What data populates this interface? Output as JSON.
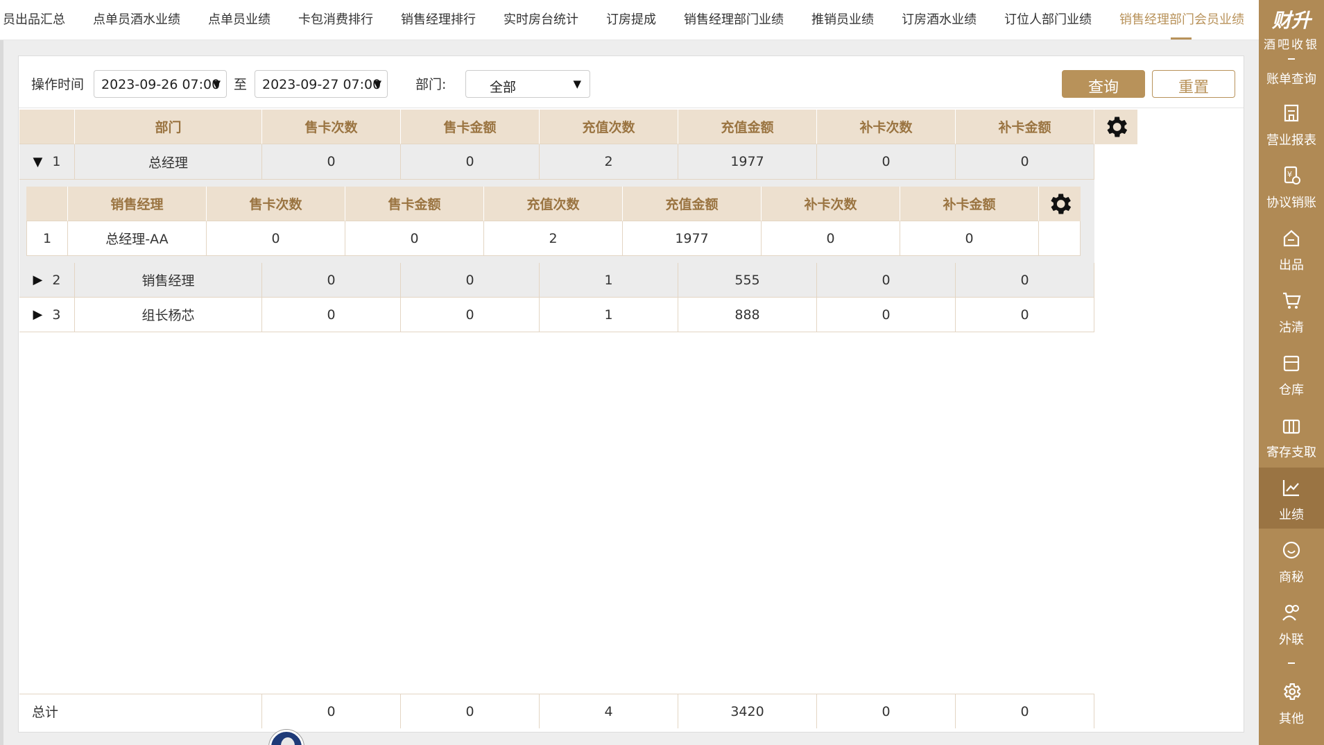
{
  "tabs": [
    {
      "label": "员出品汇总",
      "active": false
    },
    {
      "label": "点单员酒水业绩",
      "active": false
    },
    {
      "label": "点单员业绩",
      "active": false
    },
    {
      "label": "卡包消费排行",
      "active": false
    },
    {
      "label": "销售经理排行",
      "active": false
    },
    {
      "label": "实时房台统计",
      "active": false
    },
    {
      "label": "订房提成",
      "active": false
    },
    {
      "label": "销售经理部门业绩",
      "active": false
    },
    {
      "label": "推销员业绩",
      "active": false
    },
    {
      "label": "订房酒水业绩",
      "active": false
    },
    {
      "label": "订位人部门业绩",
      "active": false
    },
    {
      "label": "销售经理部门会员业绩",
      "active": true
    }
  ],
  "filters": {
    "time_label": "操作时间",
    "start": "2023-09-26 07:00",
    "to_label": "至",
    "end": "2023-09-27 07:00",
    "dept_label": "部门:",
    "dept_value": "全部",
    "query_label": "查询",
    "reset_label": "重置"
  },
  "table": {
    "columns": [
      "部门",
      "售卡次数",
      "售卡金额",
      "充值次数",
      "充值金额",
      "补卡次数",
      "补卡金额"
    ],
    "rows": [
      {
        "index": "1",
        "expanded": true,
        "dept": "总经理",
        "values": [
          "0",
          "0",
          "2",
          "1977",
          "0",
          "0"
        ]
      },
      {
        "index": "2",
        "expanded": false,
        "dept": "销售经理",
        "values": [
          "0",
          "0",
          "1",
          "555",
          "0",
          "0"
        ]
      },
      {
        "index": "3",
        "expanded": false,
        "dept": "组长杨芯",
        "values": [
          "0",
          "0",
          "1",
          "888",
          "0",
          "0"
        ]
      }
    ]
  },
  "subtable": {
    "columns": [
      "销售经理",
      "售卡次数",
      "售卡金额",
      "充值次数",
      "充值金额",
      "补卡次数",
      "补卡金额"
    ],
    "rows": [
      {
        "index": "1",
        "name": "总经理-AA",
        "values": [
          "0",
          "0",
          "2",
          "1977",
          "0",
          "0"
        ]
      }
    ]
  },
  "total": {
    "label": "总计",
    "values": [
      "0",
      "0",
      "4",
      "3420",
      "0",
      "0"
    ]
  },
  "sidebar": {
    "brand": "财升",
    "brand_sub": "酒吧收银",
    "items": [
      {
        "label": "账单查询",
        "icon": "bill-icon",
        "active": false
      },
      {
        "label": "营业报表",
        "icon": "building-icon",
        "active": false
      },
      {
        "label": "协议销账",
        "icon": "yen-doc-icon",
        "active": false
      },
      {
        "label": "出品",
        "icon": "house-return-icon",
        "active": false
      },
      {
        "label": "沽清",
        "icon": "cart-icon",
        "active": false
      },
      {
        "label": "仓库",
        "icon": "box-icon",
        "active": false
      },
      {
        "label": "寄存支取",
        "icon": "locker-icon",
        "active": false
      },
      {
        "label": "业绩",
        "icon": "chart-icon",
        "active": true
      },
      {
        "label": "商秘",
        "icon": "secretary-icon",
        "active": false
      },
      {
        "label": "外联",
        "icon": "people-icon",
        "active": false
      },
      {
        "label": "其他",
        "icon": "gear-icon",
        "active": false
      }
    ]
  }
}
